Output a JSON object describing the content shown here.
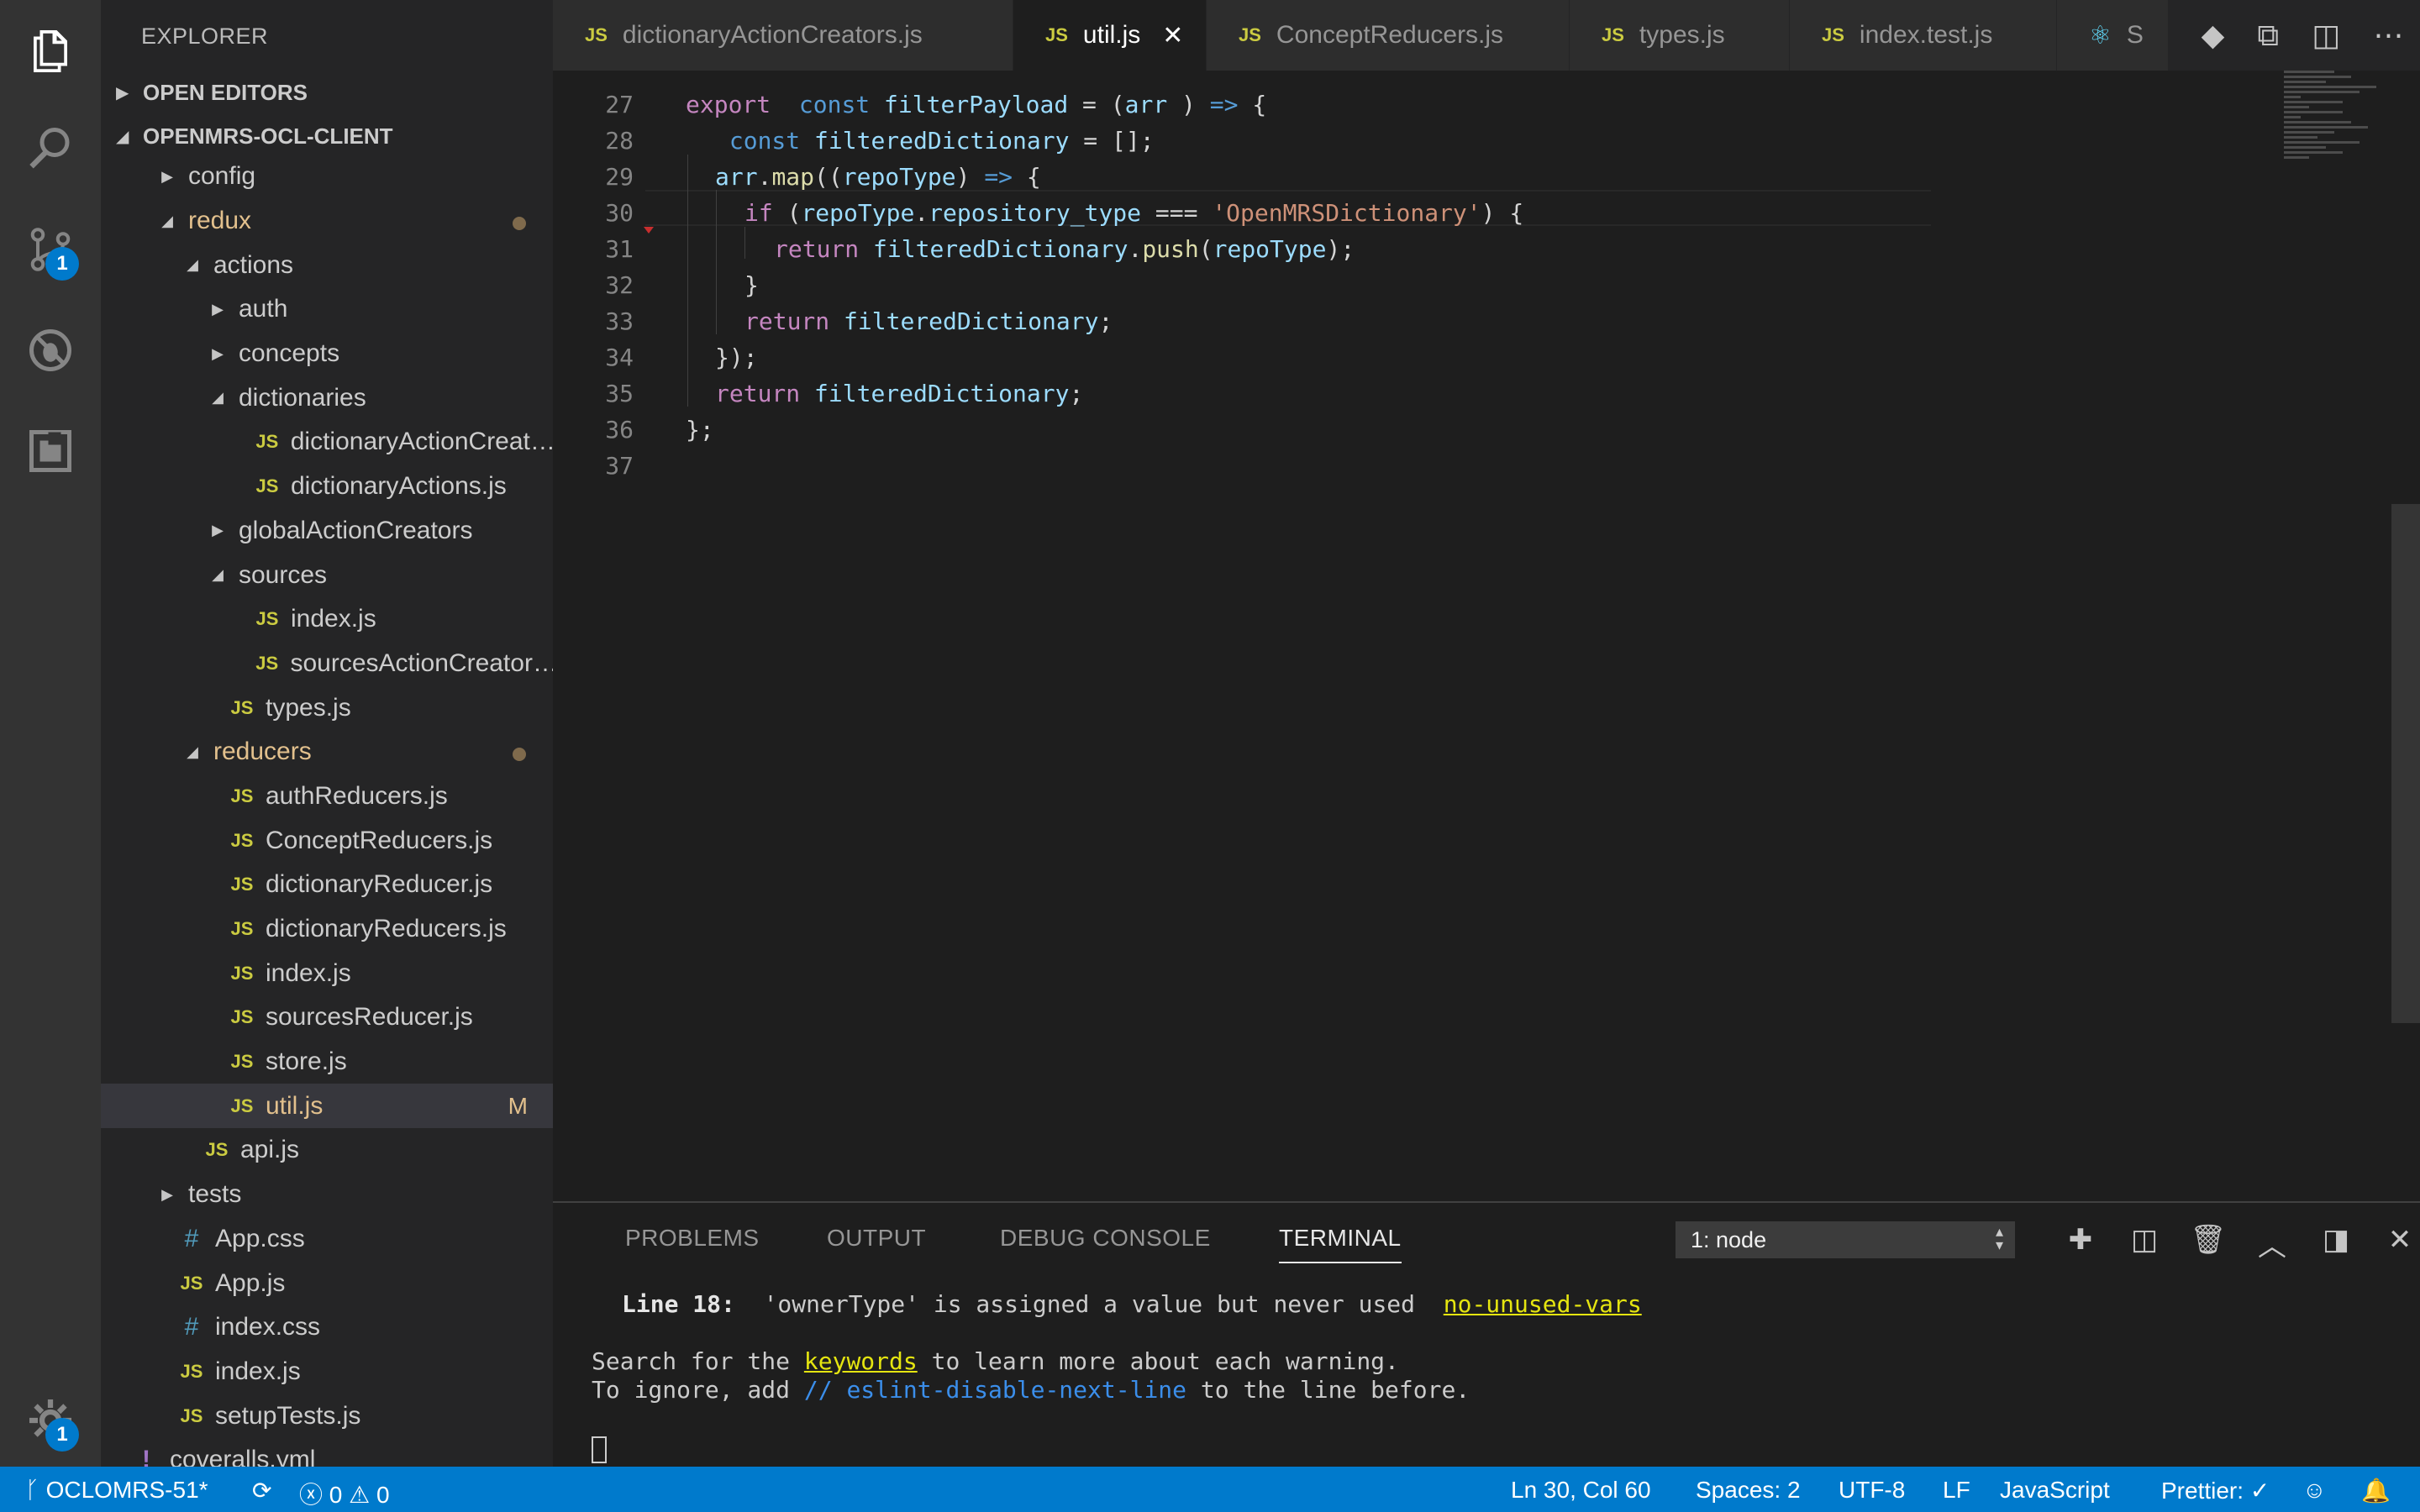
{
  "sidebar": {
    "title": "EXPLORER",
    "open_editors": "OPEN EDITORS",
    "project": "OPENMRS-OCL-CLIENT",
    "items": [
      {
        "label": "config",
        "type": "folder",
        "open": false,
        "depth": 1
      },
      {
        "label": "redux",
        "type": "folder",
        "open": true,
        "depth": 1,
        "modified": true,
        "dot": true
      },
      {
        "label": "actions",
        "type": "folder",
        "open": true,
        "depth": 2
      },
      {
        "label": "auth",
        "type": "folder",
        "open": false,
        "depth": 3
      },
      {
        "label": "concepts",
        "type": "folder",
        "open": false,
        "depth": 3
      },
      {
        "label": "dictionaries",
        "type": "folder",
        "open": true,
        "depth": 3
      },
      {
        "label": "dictionaryActionCreat…",
        "type": "js",
        "depth": 4
      },
      {
        "label": "dictionaryActions.js",
        "type": "js",
        "depth": 4
      },
      {
        "label": "globalActionCreators",
        "type": "folder",
        "open": false,
        "depth": 3
      },
      {
        "label": "sources",
        "type": "folder",
        "open": true,
        "depth": 3
      },
      {
        "label": "index.js",
        "type": "js",
        "depth": 4
      },
      {
        "label": "sourcesActionCreator…",
        "type": "js",
        "depth": 4
      },
      {
        "label": "types.js",
        "type": "js",
        "depth": 3
      },
      {
        "label": "reducers",
        "type": "folder",
        "open": true,
        "depth": 2,
        "modified": true,
        "dot": true
      },
      {
        "label": "authReducers.js",
        "type": "js",
        "depth": 3
      },
      {
        "label": "ConceptReducers.js",
        "type": "js",
        "depth": 3
      },
      {
        "label": "dictionaryReducer.js",
        "type": "js",
        "depth": 3
      },
      {
        "label": "dictionaryReducers.js",
        "type": "js",
        "depth": 3
      },
      {
        "label": "index.js",
        "type": "js",
        "depth": 3
      },
      {
        "label": "sourcesReducer.js",
        "type": "js",
        "depth": 3
      },
      {
        "label": "store.js",
        "type": "js",
        "depth": 3
      },
      {
        "label": "util.js",
        "type": "js",
        "depth": 3,
        "modified": true,
        "selected": true,
        "badge": "M"
      },
      {
        "label": "api.js",
        "type": "js",
        "depth": 2
      },
      {
        "label": "tests",
        "type": "folder",
        "open": false,
        "depth": 1
      },
      {
        "label": "App.css",
        "type": "css",
        "depth": 1
      },
      {
        "label": "App.js",
        "type": "js",
        "depth": 1
      },
      {
        "label": "index.css",
        "type": "css",
        "depth": 1
      },
      {
        "label": "index.js",
        "type": "js",
        "depth": 1
      },
      {
        "label": "setupTests.js",
        "type": "js",
        "depth": 1
      },
      {
        "label": "coveralls.yml",
        "type": "yml",
        "depth": 0
      }
    ]
  },
  "tabs": [
    {
      "label": "dictionaryActionCreators.js",
      "active": false
    },
    {
      "label": "util.js",
      "active": true,
      "close": "✕"
    },
    {
      "label": "ConceptReducers.js",
      "active": false
    },
    {
      "label": "types.js",
      "active": false
    },
    {
      "label": "index.test.js",
      "active": false
    },
    {
      "label": "S",
      "active": false,
      "icon": "react-icon"
    }
  ],
  "editor": {
    "line_numbers": [
      "27",
      "28",
      "29",
      "30",
      "31",
      "32",
      "33",
      "34",
      "35",
      "36",
      "37"
    ],
    "lines": [
      [
        [
          "kw",
          "export"
        ],
        [
          "",
          "  "
        ],
        [
          "st",
          "const"
        ],
        [
          "",
          " "
        ],
        [
          "var",
          "filterPayload"
        ],
        [
          "",
          " = ("
        ],
        [
          "var",
          "arr"
        ],
        [
          "",
          " ) "
        ],
        [
          "st",
          "=>"
        ],
        [
          "",
          " {"
        ]
      ],
      [
        [
          "",
          " "
        ],
        [
          "st",
          "const"
        ],
        [
          "",
          " "
        ],
        [
          "var",
          "filteredDictionary"
        ],
        [
          "",
          " = [];"
        ]
      ],
      [
        [
          "var",
          "arr"
        ],
        [
          "",
          "."
        ],
        [
          "fn",
          "map"
        ],
        [
          "",
          "(("
        ],
        [
          "var",
          "repoType"
        ],
        [
          "",
          ") "
        ],
        [
          "st",
          "=>"
        ],
        [
          "",
          " {"
        ]
      ],
      [
        [
          "kw",
          "if"
        ],
        [
          "",
          " ("
        ],
        [
          "var",
          "repoType"
        ],
        [
          "",
          "."
        ],
        [
          "var",
          "repository_type"
        ],
        [
          "",
          " === "
        ],
        [
          "str",
          "'OpenMRSDictionary'"
        ],
        [
          "",
          ") {"
        ]
      ],
      [
        [
          "kw",
          "return"
        ],
        [
          "",
          " "
        ],
        [
          "var",
          "filteredDictionary"
        ],
        [
          "",
          "."
        ],
        [
          "fn",
          "push"
        ],
        [
          "",
          "("
        ],
        [
          "var",
          "repoType"
        ],
        [
          "",
          ");"
        ]
      ],
      [
        [
          "",
          "}"
        ]
      ],
      [
        [
          "kw",
          "return"
        ],
        [
          "",
          " "
        ],
        [
          "var",
          "filteredDictionary"
        ],
        [
          "",
          ";"
        ]
      ],
      [
        [
          "",
          "});"
        ]
      ],
      [
        [
          "kw",
          "return"
        ],
        [
          "",
          " "
        ],
        [
          "var",
          "filteredDictionary"
        ],
        [
          "",
          ";"
        ]
      ],
      [
        [
          "",
          "};"
        ]
      ],
      []
    ]
  },
  "panel": {
    "tabs": [
      "PROBLEMS",
      "OUTPUT",
      "DEBUG CONSOLE",
      "TERMINAL"
    ],
    "active_tab": "TERMINAL",
    "terminal_select": "1: node",
    "output": {
      "line1_label": "Line 18:",
      "line1_text": "  'ownerType' is assigned a value but never used  ",
      "line1_rule": "no-unused-vars",
      "line2_pre": "Search for the ",
      "line2_link": "keywords",
      "line2_post": " to learn more about each warning.",
      "line3_pre": "To ignore, add ",
      "line3_comment": "// eslint-disable-next-line",
      "line3_post": " to the line before."
    }
  },
  "status": {
    "branch": "OCLOMRS-51*",
    "errors": "0",
    "warnings": "0",
    "position": "Ln 30, Col 60",
    "spaces": "Spaces: 2",
    "encoding": "UTF-8",
    "eol": "LF",
    "language": "JavaScript",
    "prettier": "Prettier: ✓"
  },
  "activity": {
    "scm_badge": "1",
    "settings_badge": "1"
  },
  "colors": {
    "accent": "#007acc",
    "modified": "#e2c08d",
    "js_icon": "#cbcb41"
  }
}
